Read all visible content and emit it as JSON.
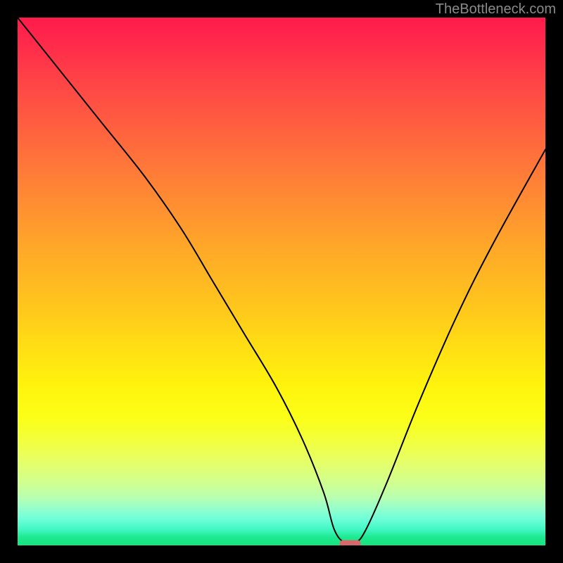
{
  "attribution": "TheBottleneck.com",
  "chart_data": {
    "type": "line",
    "title": "",
    "xlabel": "",
    "ylabel": "",
    "xlim": [
      0,
      100
    ],
    "ylim": [
      0,
      100
    ],
    "grid": false,
    "legend": false,
    "x": [
      0,
      8,
      16,
      24,
      31,
      37,
      43,
      49,
      54,
      58,
      60,
      62,
      64,
      66,
      70,
      76,
      83,
      90,
      100
    ],
    "y": [
      100,
      90,
      80,
      70,
      60,
      50,
      40,
      30,
      20,
      10,
      3,
      0.5,
      0.5,
      3,
      12,
      27,
      43,
      57,
      75
    ],
    "marker": {
      "x_range": [
        61,
        65
      ],
      "y": 0.3,
      "color": "#d66a6a",
      "shape": "pill"
    },
    "background": {
      "type": "vertical-gradient",
      "stops": [
        {
          "pos": 0.0,
          "color": "#ff1a4d"
        },
        {
          "pos": 0.5,
          "color": "#ffbf20"
        },
        {
          "pos": 0.75,
          "color": "#fcff20"
        },
        {
          "pos": 0.92,
          "color": "#b8ffb2"
        },
        {
          "pos": 1.0,
          "color": "#17e47f"
        }
      ]
    }
  }
}
